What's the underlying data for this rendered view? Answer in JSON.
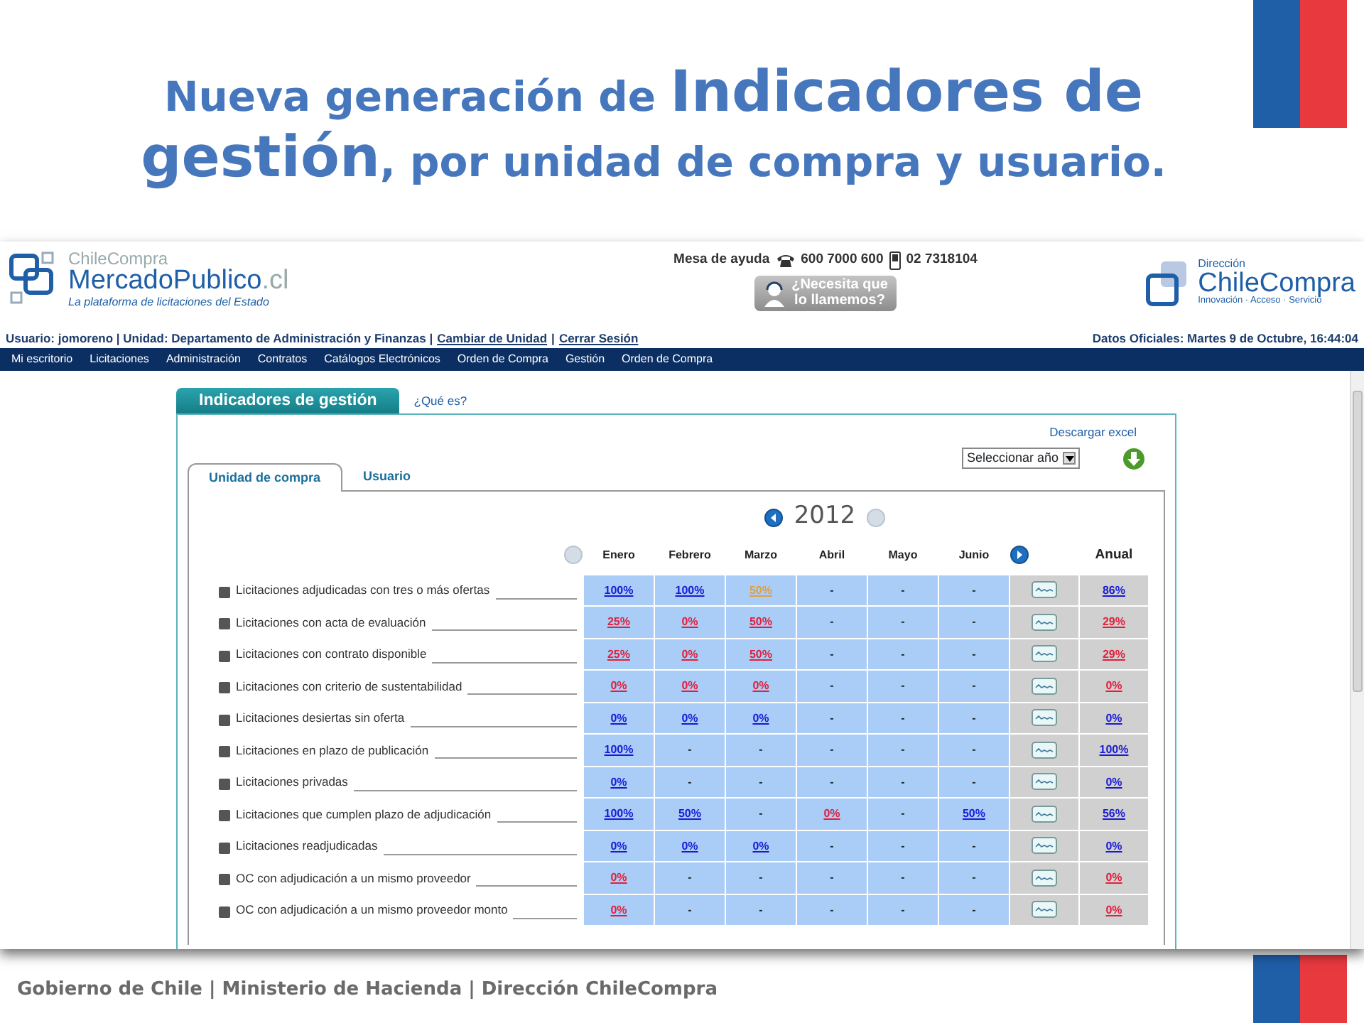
{
  "slide": {
    "title_lines": [
      [
        {
          "text": "Nueva generación de ",
          "kind": "normal"
        },
        {
          "text": "Indicadores de",
          "kind": "large"
        }
      ],
      [
        {
          "text": "gestión",
          "kind": "large"
        },
        {
          "text": ", por unidad de compra y usuario.",
          "kind": "normal"
        }
      ]
    ],
    "footer": "Gobierno de Chile | Ministerio de Hacienda | Dirección ChileCompra"
  },
  "header": {
    "logo_left": {
      "top": "ChileCompra",
      "main": "MercadoPublico",
      "suffix": ".cl",
      "tagline": "La plataforma de licitaciones del Estado"
    },
    "help_label": "Mesa de ayuda",
    "phone": "600 7000 600",
    "mobile": "02 7318104",
    "callback_button": [
      "¿Necesita que",
      "lo llamemos?"
    ],
    "logo_right": {
      "top": "Dirección",
      "main": "ChileCompra",
      "tagline": "Innovación · Acceso · Servicio"
    }
  },
  "user_bar": {
    "parts": [
      {
        "kind": "text",
        "text": "Usuario: jomoreno | Unidad: Departamento de Administración y Finanzas |"
      },
      {
        "kind": "link",
        "text": "Cambiar de Unidad"
      },
      {
        "kind": "text",
        "text": "|"
      },
      {
        "kind": "link",
        "text": "Cerrar Sesión"
      }
    ],
    "date": "Datos Oficiales: Martes 9 de Octubre, 16:44:04"
  },
  "menu": [
    "Mi escritorio",
    "Licitaciones",
    "Administración",
    "Contratos",
    "Catálogos Electrónicos",
    "Orden de Compra",
    "Gestión",
    "Orden de Compra"
  ],
  "panel": {
    "tab": "Indicadores de gestión",
    "help_link": "¿Qué es?",
    "download_link": "Descargar excel",
    "year_select": "Seleccionar año",
    "tabs": [
      {
        "label": "Unidad de compra",
        "selected": true
      },
      {
        "label": "Usuario",
        "selected": false
      }
    ],
    "year": "2012",
    "year_prev": {
      "disabled": false
    },
    "year_next": {
      "disabled": true
    },
    "months_prev": {
      "disabled": true
    },
    "months_next": {
      "disabled": false
    },
    "columns": [
      "Enero",
      "Febrero",
      "Marzo",
      "Abril",
      "Mayo",
      "Junio"
    ],
    "total_column": "Anual",
    "rows": [
      {
        "label": "Licitaciones adjudicadas con tres o más ofertas",
        "cells": [
          {
            "text": "100%",
            "color": "#1a1ad6"
          },
          {
            "text": "100%",
            "color": "#1a1ad6"
          },
          {
            "text": "50%",
            "color": "#e0a040"
          },
          {
            "text": "-"
          },
          {
            "text": "-"
          },
          {
            "text": "-"
          }
        ],
        "total": {
          "text": "86%",
          "color": "#1a1ad6"
        }
      },
      {
        "label": "Licitaciones con acta de evaluación",
        "cells": [
          {
            "text": "25%",
            "color": "#e0203c"
          },
          {
            "text": "0%",
            "color": "#e0203c"
          },
          {
            "text": "50%",
            "color": "#e0203c"
          },
          {
            "text": "-"
          },
          {
            "text": "-"
          },
          {
            "text": "-"
          }
        ],
        "total": {
          "text": "29%",
          "color": "#e0203c"
        }
      },
      {
        "label": "Licitaciones con contrato disponible",
        "cells": [
          {
            "text": "25%",
            "color": "#e0203c"
          },
          {
            "text": "0%",
            "color": "#e0203c"
          },
          {
            "text": "50%",
            "color": "#e0203c"
          },
          {
            "text": "-"
          },
          {
            "text": "-"
          },
          {
            "text": "-"
          }
        ],
        "total": {
          "text": "29%",
          "color": "#e0203c"
        }
      },
      {
        "label": "Licitaciones con criterio de sustentabilidad",
        "cells": [
          {
            "text": "0%",
            "color": "#e0203c"
          },
          {
            "text": "0%",
            "color": "#e0203c"
          },
          {
            "text": "0%",
            "color": "#e0203c"
          },
          {
            "text": "-"
          },
          {
            "text": "-"
          },
          {
            "text": "-"
          }
        ],
        "total": {
          "text": "0%",
          "color": "#e0203c"
        }
      },
      {
        "label": "Licitaciones desiertas sin oferta",
        "cells": [
          {
            "text": "0%",
            "color": "#1a1ad6"
          },
          {
            "text": "0%",
            "color": "#1a1ad6"
          },
          {
            "text": "0%",
            "color": "#1a1ad6"
          },
          {
            "text": "-"
          },
          {
            "text": "-"
          },
          {
            "text": "-"
          }
        ],
        "total": {
          "text": "0%",
          "color": "#1a1ad6"
        }
      },
      {
        "label": "Licitaciones en plazo de publicación",
        "cells": [
          {
            "text": "100%",
            "color": "#1a1ad6"
          },
          {
            "text": "-"
          },
          {
            "text": "-"
          },
          {
            "text": "-"
          },
          {
            "text": "-"
          },
          {
            "text": "-"
          }
        ],
        "total": {
          "text": "100%",
          "color": "#1a1ad6"
        }
      },
      {
        "label": "Licitaciones privadas",
        "cells": [
          {
            "text": "0%",
            "color": "#1a1ad6"
          },
          {
            "text": "-"
          },
          {
            "text": "-"
          },
          {
            "text": "-"
          },
          {
            "text": "-"
          },
          {
            "text": "-"
          }
        ],
        "total": {
          "text": "0%",
          "color": "#1a1ad6"
        }
      },
      {
        "label": "Licitaciones que cumplen plazo de adjudicación",
        "cells": [
          {
            "text": "100%",
            "color": "#1a1ad6"
          },
          {
            "text": "50%",
            "color": "#1a1ad6"
          },
          {
            "text": "-"
          },
          {
            "text": "0%",
            "color": "#e0203c"
          },
          {
            "text": "-"
          },
          {
            "text": "50%",
            "color": "#1a1ad6"
          }
        ],
        "total": {
          "text": "56%",
          "color": "#1a1ad6"
        }
      },
      {
        "label": "Licitaciones readjudicadas",
        "cells": [
          {
            "text": "0%",
            "color": "#1a1ad6"
          },
          {
            "text": "0%",
            "color": "#1a1ad6"
          },
          {
            "text": "0%",
            "color": "#1a1ad6"
          },
          {
            "text": "-"
          },
          {
            "text": "-"
          },
          {
            "text": "-"
          }
        ],
        "total": {
          "text": "0%",
          "color": "#1a1ad6"
        }
      },
      {
        "label": "OC con adjudicación a un mismo proveedor",
        "cells": [
          {
            "text": "0%",
            "color": "#e0203c"
          },
          {
            "text": "-"
          },
          {
            "text": "-"
          },
          {
            "text": "-"
          },
          {
            "text": "-"
          },
          {
            "text": "-"
          }
        ],
        "total": {
          "text": "0%",
          "color": "#e0203c"
        }
      },
      {
        "label": "OC con adjudicación a un mismo proveedor monto",
        "cells": [
          {
            "text": "0%",
            "color": "#e0203c"
          },
          {
            "text": "-"
          },
          {
            "text": "-"
          },
          {
            "text": "-"
          },
          {
            "text": "-"
          },
          {
            "text": "-"
          }
        ],
        "total": {
          "text": "0%",
          "color": "#e0203c"
        }
      }
    ]
  }
}
